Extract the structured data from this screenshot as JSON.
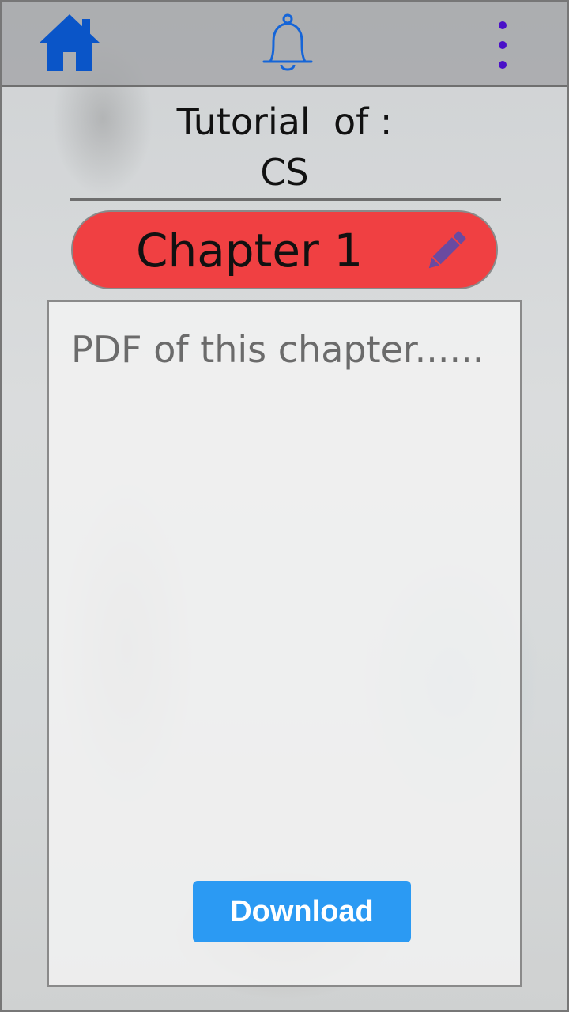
{
  "topbar": {
    "icons": [
      "home-icon",
      "bell-icon",
      "more-vertical-icon"
    ]
  },
  "title": {
    "line1": "Tutorial  of :",
    "line2": "CS"
  },
  "chapter": {
    "label": "Chapter 1",
    "edit_icon": "pencil-icon"
  },
  "content": {
    "placeholder": "PDF of this chapter......",
    "download_label": "Download"
  },
  "colors": {
    "home_icon": "#0a55c8",
    "bell_icon": "#1565d8",
    "menu_dots": "#4a10c8",
    "chapter_pill": "#f04042",
    "edit_icon": "#6a4aa0",
    "download_button": "#2b9af3"
  }
}
